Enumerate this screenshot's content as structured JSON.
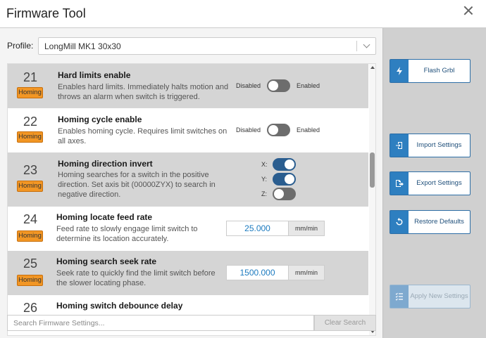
{
  "window": {
    "title": "Firmware Tool"
  },
  "profile": {
    "label": "Profile:",
    "value": "LongMill MK1 30x30"
  },
  "settings": [
    {
      "num": "21",
      "badge": "Homing",
      "name": "Hard limits enable",
      "desc": "Enables hard limits. Immediately halts motion and throws an alarm when switch is triggered.",
      "off_label": "Disabled",
      "on_label": "Enabled"
    },
    {
      "num": "22",
      "badge": "Homing",
      "name": "Homing cycle enable",
      "desc": "Enables homing cycle. Requires limit switches on all axes.",
      "off_label": "Disabled",
      "on_label": "Enabled"
    },
    {
      "num": "23",
      "badge": "Homing",
      "name": "Homing direction invert",
      "desc": "Homing searches for a switch in the positive direction. Set axis bit (00000ZYX) to search in negative direction.",
      "axes": [
        "X:",
        "Y:",
        "Z:"
      ]
    },
    {
      "num": "24",
      "badge": "Homing",
      "name": "Homing locate feed rate",
      "desc": "Feed rate to slowly engage limit switch to determine its location accurately.",
      "value": "25.000",
      "unit": "mm/min"
    },
    {
      "num": "25",
      "badge": "Homing",
      "name": "Homing search seek rate",
      "desc": "Seek rate to quickly find the limit switch before the slower locating phase.",
      "value": "1500.000",
      "unit": "mm/min"
    },
    {
      "num": "26",
      "name": "Homing switch debounce delay"
    }
  ],
  "search": {
    "placeholder": "Search Firmware Settings...",
    "clear_label": "Clear Search"
  },
  "sidebar": {
    "flash": "Flash Grbl",
    "import": "Import Settings",
    "export": "Export Settings",
    "restore": "Restore Defaults",
    "apply": "Apply New Settings"
  },
  "colors": {
    "badge": "#f29624",
    "toggle_on": "#2a5d8f",
    "accent": "#2e7fc0"
  }
}
